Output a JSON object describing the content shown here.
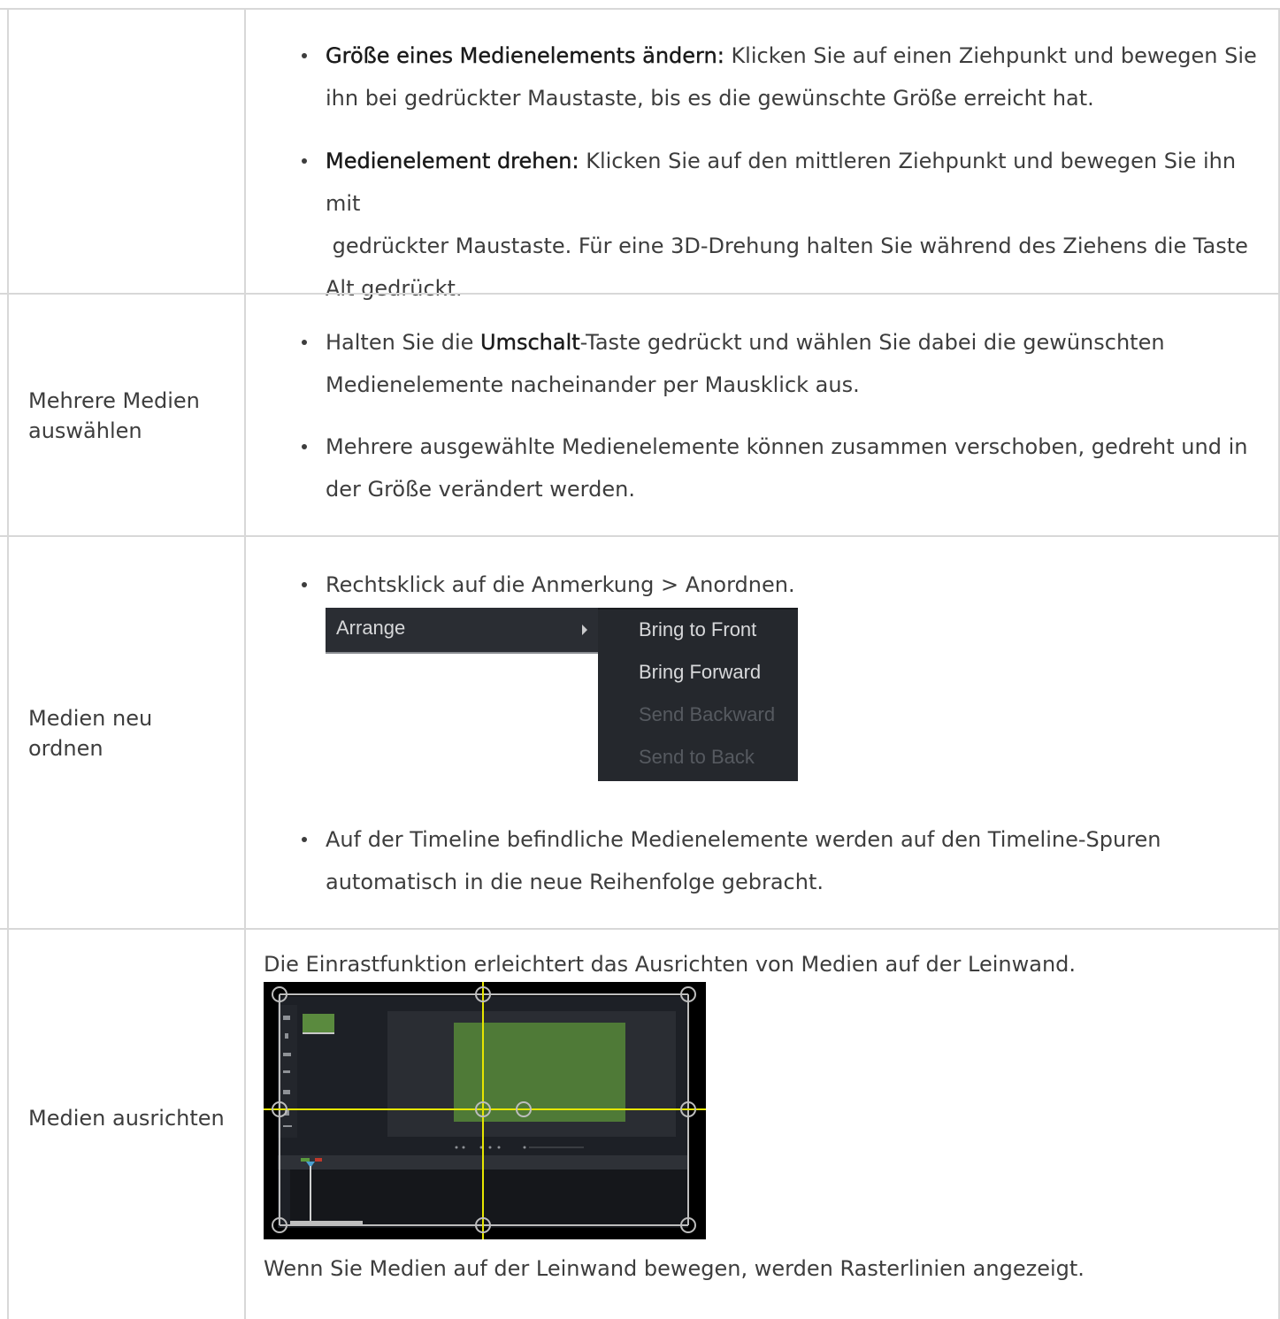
{
  "rows": [
    {
      "label": "",
      "bullets": [
        {
          "bold": "Größe eines Medienelements ändern:",
          "lines": [
            "Klicken Sie auf einen Ziehpunkt und bewegen Sie",
            "ihn bei gedrückter Maustaste, bis es die gewünschte Größe erreicht hat."
          ]
        },
        {
          "bold": "Medienelement drehen:",
          "lines": [
            "Klicken Sie auf den mittleren Ziehpunkt und bewegen Sie ihn mit",
            " gedrückter Maustaste. Für eine 3D-Drehung halten Sie während des Ziehens die Taste",
            "Alt gedrückt."
          ]
        }
      ]
    },
    {
      "label_lines": [
        "Mehrere Medien",
        "auswählen"
      ],
      "bullets": [
        {
          "pre": "Halten Sie die ",
          "bold": "Umschalt",
          "post": "-Taste gedrückt und wählen Sie dabei die gewünschten",
          "line2": "Medienelemente nacheinander per Mausklick aus."
        },
        {
          "line1": "Mehrere ausgewählte Medienelemente können zusammen verschoben, gedreht und in",
          "line2": "der Größe verändert werden."
        }
      ]
    },
    {
      "label_lines": [
        "Medien neu",
        "ordnen"
      ],
      "bullet1": "Rechtsklick auf die Anmerkung > Anordnen.",
      "menu": {
        "main": "Arrange",
        "sub": [
          "Bring to Front",
          "Bring Forward",
          "Send Backward",
          "Send to Back"
        ]
      },
      "bullet2_line1": "Auf der Timeline befindliche Medienelemente werden auf den Timeline-Spuren",
      "bullet2_line2": "automatisch in die neue Reihenfolge gebracht."
    },
    {
      "label": "Medien ausrichten",
      "intro": "Die Einrastfunktion erleichtert das Ausrichten von Medien auf der Leinwand.",
      "outro": "Wenn Sie Medien auf der Leinwand bewegen, werden Rasterlinien angezeigt."
    }
  ],
  "colors": {
    "border": "#d8d8d8",
    "text": "#3d3d3d",
    "menu_bg": "#2a2d33",
    "guide_yellow": "#e6e600",
    "media_green": "#4f7a37"
  }
}
